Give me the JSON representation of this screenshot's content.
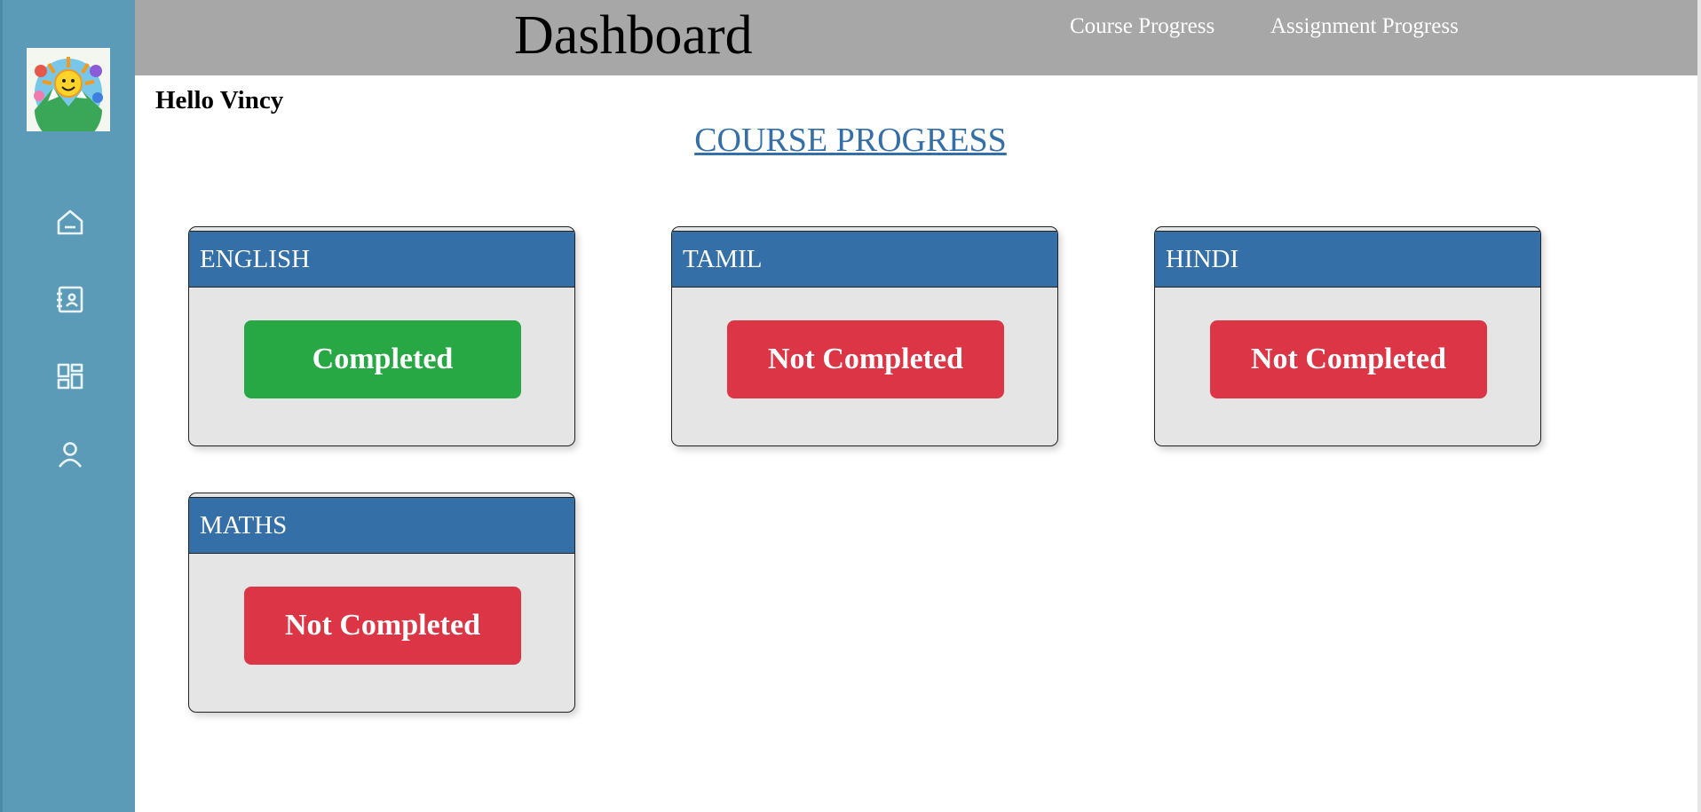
{
  "header": {
    "title": "Dashboard",
    "nav": [
      "Course Progress",
      "Assignment Progress"
    ]
  },
  "sidebar": {
    "icons": [
      "home-icon",
      "contact-card-icon",
      "dashboard-grid-icon",
      "user-icon"
    ]
  },
  "greeting": "Hello Vincy",
  "section_title": "COURSE PROGRESS",
  "courses": [
    {
      "name": "ENGLISH",
      "status": "Completed",
      "completed": true
    },
    {
      "name": "TAMIL",
      "status": "Not Completed",
      "completed": false
    },
    {
      "name": "HINDI",
      "status": "Not Completed",
      "completed": false
    },
    {
      "name": "MATHS",
      "status": "Not Completed",
      "completed": false
    }
  ],
  "colors": {
    "sidebar": "#5b9bb8",
    "topbar": "#a7a7a7",
    "accent": "#346fa8",
    "completed": "#28a745",
    "not_completed": "#dc3545"
  }
}
